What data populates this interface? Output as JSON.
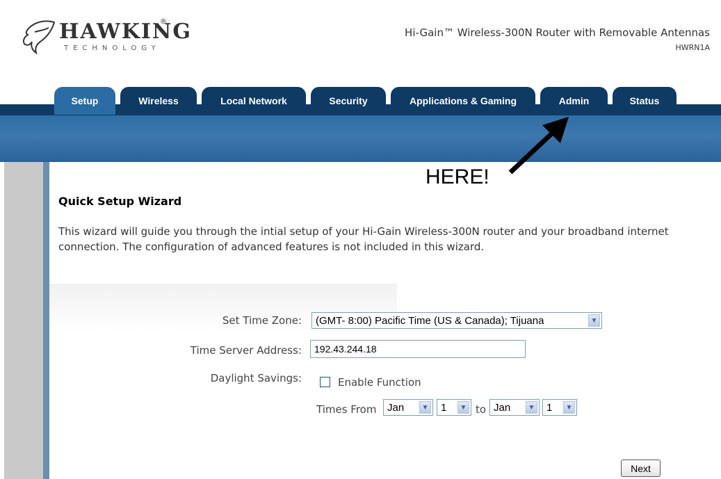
{
  "brand": {
    "name": "HAWKING",
    "sub": "TECHNOLOGY",
    "reg": "®"
  },
  "product": {
    "title": "Hi-Gain™ Wireless-300N Router with Removable Antennas",
    "model": "HWRN1A"
  },
  "tabs": [
    {
      "label": "Setup",
      "active": true
    },
    {
      "label": "Wireless",
      "active": false
    },
    {
      "label": "Local Network",
      "active": false
    },
    {
      "label": "Security",
      "active": false
    },
    {
      "label": "Applications & Gaming",
      "active": false
    },
    {
      "label": "Admin",
      "active": false
    },
    {
      "label": "Status",
      "active": false
    }
  ],
  "annotation": {
    "text": "HERE!"
  },
  "wizard": {
    "title": "Quick Setup Wizard",
    "intro": "This wizard will guide you through the intial setup of your Hi-Gain Wireless-300N router and your broadband internet connection. The configuration of advanced features is not included in this wizard."
  },
  "form": {
    "timezone_label": "Set Time Zone:",
    "timezone_value": "(GMT- 8:00) Pacific Time (US & Canada); Tijuana",
    "timeserver_label": "Time Server Address:",
    "timeserver_value": "192.43.244.18",
    "daylight_label": "Daylight Savings:",
    "enable_label": "Enable Function",
    "enable_checked": false,
    "times_from_label": "Times From",
    "from_month": "Jan",
    "from_day": "1",
    "to_label": "to",
    "to_month": "Jan",
    "to_day": "1"
  },
  "buttons": {
    "next": "Next"
  },
  "colors": {
    "nav_dark": "#0e3a64",
    "nav_active": "#2b6ca4",
    "band": "#3e77ae",
    "arrow": "#000000"
  },
  "icons": {
    "dropdown": "chevron-down-icon",
    "logo": "hawk-logo-icon",
    "pointer": "arrow-pointer-icon"
  }
}
